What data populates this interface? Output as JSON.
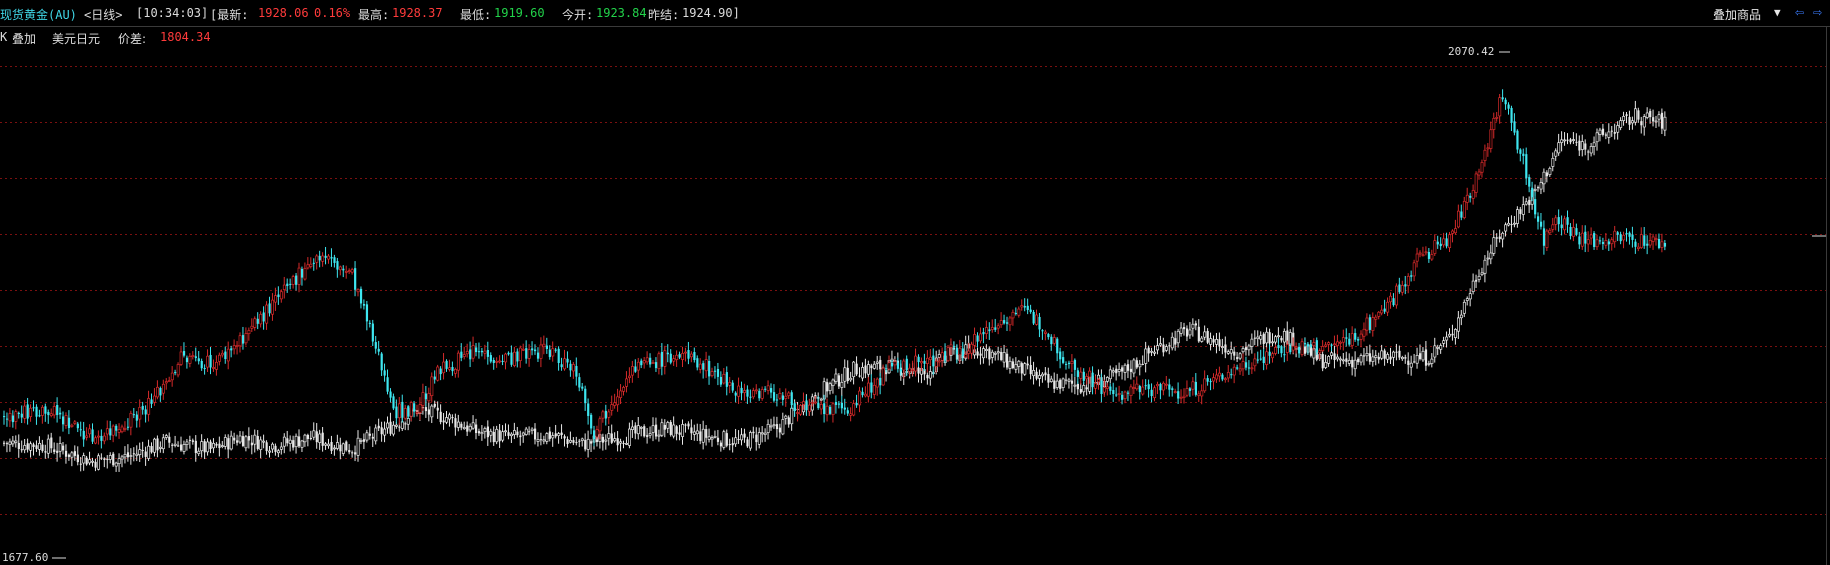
{
  "header": {
    "name": "现货黄金(AU)",
    "period": "<日线>",
    "time": "[10:34:03]",
    "latest_label": "[最新:",
    "latest_price": "1928.06",
    "latest_change": "0.16%",
    "high_label": "最高:",
    "high_value": "1928.37",
    "low_label": "最低:",
    "low_value": "1919.60",
    "open_label": "今开:",
    "open_value": "1923.84",
    "prev_close_label": "昨结:",
    "prev_close_value": "1924.90]",
    "overlay_button": "叠加商品",
    "dropdown_arrow": "▼",
    "nav_left_icon": "⇦",
    "nav_right_icon": "⇨"
  },
  "subheader": {
    "k_label": "K",
    "overlay_label": "叠加",
    "overlay_symbol": "美元日元",
    "diff_label": "价差:",
    "diff_value": "1804.34"
  },
  "colors": {
    "up": "#d62a2a",
    "down": "#3ee6f0",
    "overlay": "#e8e8e8",
    "grid": "#7a1010",
    "accent_red": "#ff3b3b",
    "accent_green": "#22d24a",
    "accent_cyan": "#3fd6e6"
  },
  "chart_data": {
    "type": "candlestick",
    "title": "现货黄金(AU) 日线",
    "grid": true,
    "ylim": [
      1640,
      2100
    ],
    "high_marker": "2070.42",
    "low_marker": "1677.60",
    "series": [
      {
        "name": "现货黄金(AU)",
        "anchors": [
          [
            0,
            1770
          ],
          [
            14,
            1778
          ],
          [
            30,
            1752
          ],
          [
            38,
            1760
          ],
          [
            50,
            1783
          ],
          [
            60,
            1822
          ],
          [
            72,
            1818
          ],
          [
            85,
            1852
          ],
          [
            95,
            1880
          ],
          [
            103,
            1907
          ],
          [
            108,
            1912
          ],
          [
            118,
            1895
          ],
          [
            126,
            1830
          ],
          [
            133,
            1775
          ],
          [
            140,
            1778
          ],
          [
            148,
            1812
          ],
          [
            160,
            1828
          ],
          [
            170,
            1822
          ],
          [
            184,
            1830
          ],
          [
            194,
            1811
          ],
          [
            200,
            1757
          ],
          [
            212,
            1812
          ],
          [
            228,
            1825
          ],
          [
            236,
            1818
          ],
          [
            250,
            1792
          ],
          [
            260,
            1792
          ],
          [
            272,
            1777
          ],
          [
            286,
            1776
          ],
          [
            300,
            1812
          ],
          [
            314,
            1820
          ],
          [
            326,
            1832
          ],
          [
            336,
            1852
          ],
          [
            344,
            1865
          ],
          [
            352,
            1852
          ],
          [
            360,
            1820
          ],
          [
            376,
            1789
          ],
          [
            390,
            1796
          ],
          [
            400,
            1791
          ],
          [
            410,
            1802
          ],
          [
            420,
            1816
          ],
          [
            432,
            1830
          ],
          [
            450,
            1832
          ],
          [
            458,
            1841
          ],
          [
            470,
            1872
          ],
          [
            480,
            1912
          ],
          [
            490,
            1928
          ],
          [
            498,
            1975
          ],
          [
            508,
            2055
          ],
          [
            514,
            2004
          ],
          [
            522,
            1925
          ],
          [
            526,
            1948
          ],
          [
            536,
            1924
          ],
          [
            546,
            1928
          ],
          [
            558,
            1925
          ],
          [
            563,
            1922
          ]
        ],
        "up_color": "#d62a2a",
        "down_color": "#3ee6f0"
      },
      {
        "name": "美元日元",
        "anchors": [
          [
            0,
            1747
          ],
          [
            14,
            1745
          ],
          [
            30,
            1731
          ],
          [
            42,
            1735
          ],
          [
            55,
            1748
          ],
          [
            70,
            1741
          ],
          [
            80,
            1752
          ],
          [
            92,
            1745
          ],
          [
            104,
            1752
          ],
          [
            118,
            1742
          ],
          [
            130,
            1760
          ],
          [
            140,
            1776
          ],
          [
            150,
            1770
          ],
          [
            160,
            1757
          ],
          [
            172,
            1752
          ],
          [
            186,
            1754
          ],
          [
            196,
            1746
          ],
          [
            210,
            1753
          ],
          [
            224,
            1760
          ],
          [
            240,
            1752
          ],
          [
            250,
            1748
          ],
          [
            262,
            1760
          ],
          [
            276,
            1791
          ],
          [
            288,
            1812
          ],
          [
            300,
            1815
          ],
          [
            312,
            1808
          ],
          [
            320,
            1825
          ],
          [
            332,
            1830
          ],
          [
            342,
            1816
          ],
          [
            354,
            1800
          ],
          [
            366,
            1798
          ],
          [
            378,
            1807
          ],
          [
            390,
            1830
          ],
          [
            402,
            1847
          ],
          [
            418,
            1828
          ],
          [
            432,
            1846
          ],
          [
            446,
            1820
          ],
          [
            458,
            1820
          ],
          [
            470,
            1823
          ],
          [
            482,
            1822
          ],
          [
            490,
            1840
          ],
          [
            500,
            1900
          ],
          [
            508,
            1935
          ],
          [
            520,
            1972
          ],
          [
            528,
            2015
          ],
          [
            536,
            2010
          ],
          [
            546,
            2025
          ],
          [
            553,
            2036
          ],
          [
            563,
            2030
          ]
        ],
        "color": "#e8e8e8"
      }
    ]
  }
}
